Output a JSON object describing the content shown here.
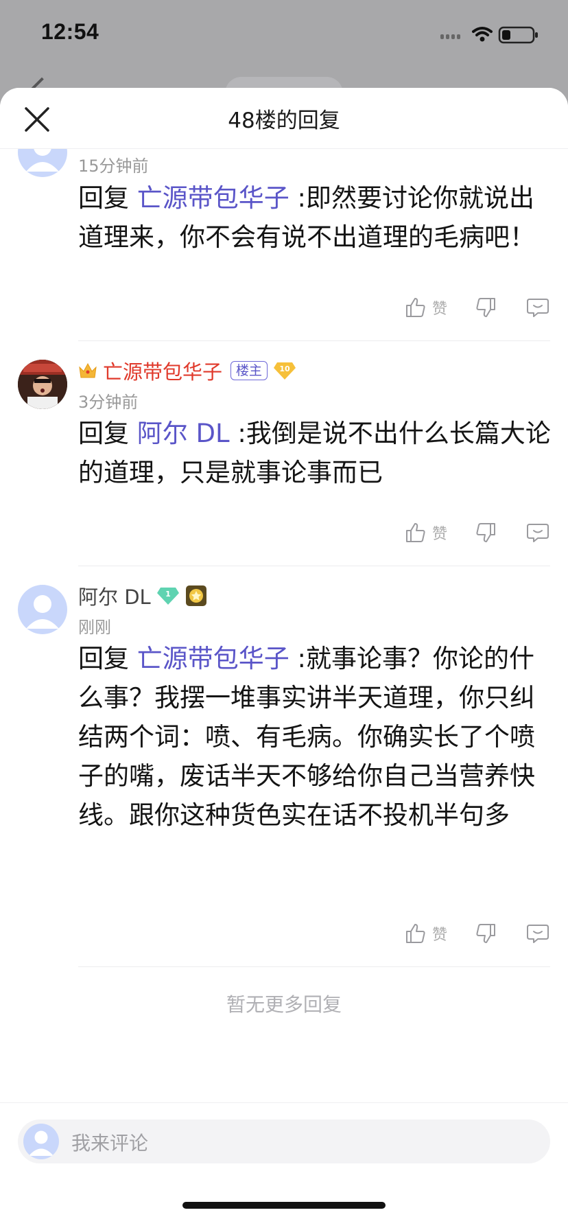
{
  "status_bar": {
    "time": "12:54"
  },
  "sheet": {
    "title": "48楼的回复",
    "close_icon": "close-icon"
  },
  "replies": [
    {
      "time": "15分钟前",
      "prefix": "回复 ",
      "mention": "亡源带包华子",
      "text": " :即然要讨论你就说出道理来，你不会有说不出道理的毛病吧！",
      "like_label": "赞"
    },
    {
      "username": "亡源带包华子",
      "owner_badge": "楼主",
      "level": "10",
      "time": "3分钟前",
      "prefix": "回复 ",
      "mention": "阿尔 DL",
      "text": " :我倒是说不出什么长篇大论的道理，只是就事论事而已",
      "like_label": "赞"
    },
    {
      "username": "阿尔 DL",
      "level": "1",
      "time": "刚刚",
      "prefix": "回复 ",
      "mention": "亡源带包华子",
      "text": " :就事论事？你论的什么事？我摆一堆事实讲半天道理，你只纠结两个词：喷、有毛病。你确实长了个喷子的嘴，废话半天不够给你自己当营养快线。跟你这种货色实在话不投机半句多",
      "like_label": "赞"
    }
  ],
  "footer": {
    "no_more": "暂无更多回复",
    "comment_placeholder": "我来评论"
  },
  "colors": {
    "mention": "#5a55c8",
    "owner_name": "#e0392b",
    "time": "#999999"
  }
}
